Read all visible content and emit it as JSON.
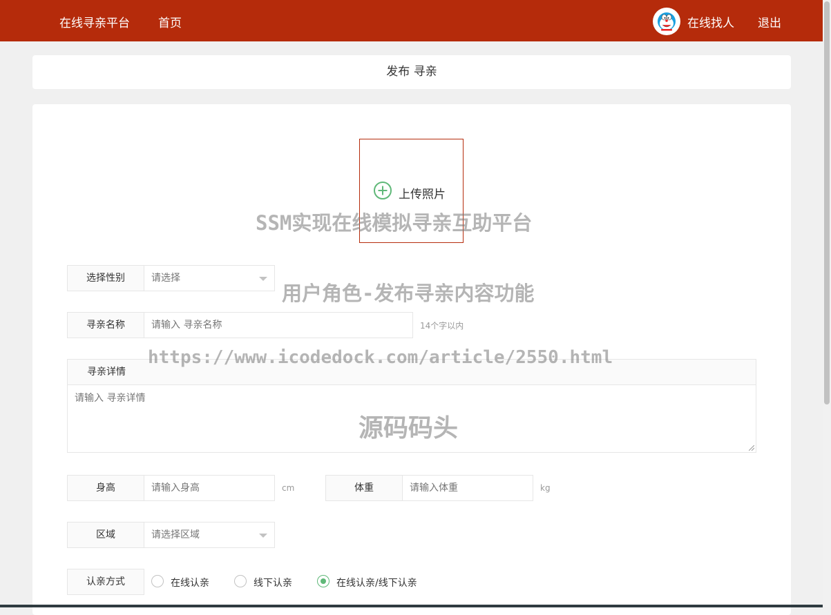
{
  "navbar": {
    "brand": "在线寻亲平台",
    "home": "首页",
    "username": "在线找人",
    "logout": "退出",
    "avatar_icon": "doraemon-avatar-icon"
  },
  "page_title": "发布 寻亲",
  "upload": {
    "label": "上传照片",
    "icon": "plus-circle-icon",
    "accent": "#5fb878",
    "border": "#b52b0b"
  },
  "form": {
    "gender": {
      "label": "选择性别",
      "placeholder": "请选择"
    },
    "name": {
      "label": "寻亲名称",
      "placeholder": "请输入 寻亲名称",
      "hint": "14个字以内"
    },
    "detail": {
      "label": "寻亲详情",
      "placeholder": "请输入 寻亲详情"
    },
    "height": {
      "label": "身高",
      "placeholder": "请输入身高",
      "unit": "cm"
    },
    "weight": {
      "label": "体重",
      "placeholder": "请输入体重",
      "unit": "kg"
    },
    "region": {
      "label": "区域",
      "placeholder": "请选择区域"
    },
    "method": {
      "label": "认亲方式",
      "options": [
        "在线认亲",
        "线下认亲",
        "在线认亲/线下认亲"
      ],
      "selected": 2
    }
  },
  "watermarks": {
    "title": "SSM实现在线模拟寻亲互助平台",
    "subtitle": "用户角色-发布寻亲内容功能",
    "url": "https://www.icodedock.com/article/2550.html",
    "brand": "源码码头"
  },
  "colors": {
    "header": "#b52b0b",
    "radio_selected": "#5fb878"
  }
}
